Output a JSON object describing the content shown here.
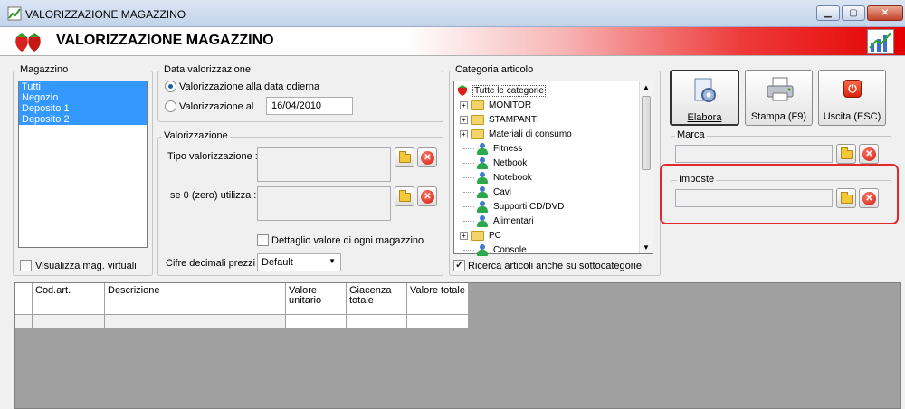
{
  "window": {
    "title": "VALORIZZAZIONE MAGAZZINO"
  },
  "banner": {
    "title": "VALORIZZAZIONE MAGAZZINO"
  },
  "magazzino": {
    "label": "Magazzino",
    "items": [
      "Tutti",
      "Negozio",
      "Deposito 1",
      "Deposito 2"
    ],
    "virtual_label": "Visualizza mag. virtuali"
  },
  "data_val": {
    "label": "Data valorizzazione",
    "option_today": "Valorizzazione alla data odierna",
    "option_at": "Valorizzazione al",
    "date": "16/04/2010"
  },
  "valorizzazione": {
    "label": "Valorizzazione",
    "tipo_label": "Tipo valorizzazione :",
    "zero_label": "se 0 (zero) utilizza :",
    "dettaglio_label": "Dettaglio valore di ogni magazzino",
    "decimali_label": "Cifre decimali prezzi :",
    "decimali_value": "Default"
  },
  "categoria": {
    "label": "Categoria articolo",
    "root": "Tutte le categorie",
    "items": [
      "MONITOR",
      "STAMPANTI",
      "Materiali di consumo",
      "Fitness",
      "Netbook",
      "Notebook",
      "Cavi",
      "Supporti CD/DVD",
      "Alimentari",
      "PC",
      "Console"
    ],
    "sub_label": "Ricerca articoli anche su sottocategorie"
  },
  "buttons": {
    "elabora": "Elabora",
    "stampa": "Stampa (F9)",
    "uscita": "Uscita (ESC)"
  },
  "marca": {
    "label": "Marca"
  },
  "imposte": {
    "label": "Imposte"
  },
  "table": {
    "headers": [
      "Cod.art.",
      "Descrizione",
      "Valore unitario",
      "Giacenza totale",
      "Valore totale"
    ]
  },
  "colors": {
    "selection": "#3399ff",
    "highlight": "#e12b2b",
    "banner_red": "#e40000"
  }
}
